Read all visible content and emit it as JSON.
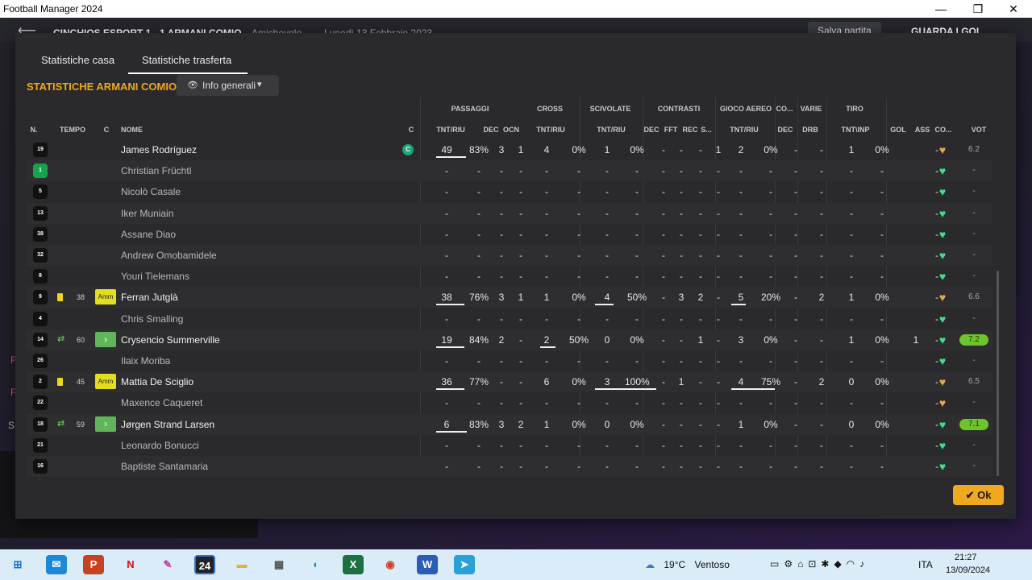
{
  "window": {
    "title": "Football Manager 2024",
    "minimize": "—",
    "maximize": "❐",
    "close": "✕"
  },
  "background": {
    "back": "⟵",
    "score": "CINCHIOS ESPORT 1 - 1 ARMANI COMIO",
    "competition": "Amichevole",
    "date": "Lunedì 13 Febbraio 2023",
    "save": "Salva partita",
    "watch": "GUARDA I GOL",
    "side_letters": [
      "F",
      "F",
      "S"
    ]
  },
  "modal": {
    "tabs": [
      "Statistiche casa",
      "Statistiche trasferta"
    ],
    "team_title": "STATISTICHE ARMANI COMIO",
    "dropdown": {
      "icon": "eye-icon",
      "label": "Info generali",
      "chevron": "⌄"
    },
    "ok_label": "Ok"
  },
  "groups": [
    "PASSAGGI",
    "CROSS",
    "SCIVOLATE",
    "CONTRASTI",
    "GIOCO AEREO",
    "CO...",
    "VARIE",
    "TIRO"
  ],
  "columns": [
    "N.",
    "TEMPO",
    "C",
    "NOME",
    "C",
    "TNT/RIU",
    "DEC",
    "OCN",
    "TNT/RIU",
    "TNT/RIU",
    "DEC",
    "FFT",
    "REC",
    "S...",
    "TNT/RIU",
    "DEC",
    "DRB",
    "TNT\\INP",
    "GOL",
    "ASS",
    "CO...",
    "VOT"
  ],
  "players": [
    {
      "n": "19",
      "gk": false,
      "name": "James Rodríguez",
      "event": "",
      "minute": "",
      "badge": "",
      "captain": "C",
      "pt": "49",
      "pr": "83%",
      "pd": "3",
      "po": "1",
      "ct": "4",
      "cr": "0%",
      "st": "1",
      "sr": "0%",
      "kd": "-",
      "kf": "-",
      "kr": "-",
      "ks": "1",
      "at": "2",
      "ar": "0%",
      "od": "-",
      "vd": "-",
      "tt": "1",
      "ti": "0%",
      "gol": "",
      "ass": "-",
      "mood": "orange",
      "vot": "6.2",
      "good": false,
      "pbar": 0.58,
      "cbar": 0,
      "sbar": 0,
      "abar": 0
    },
    {
      "n": "1",
      "gk": true,
      "name": "Christian Früchtl",
      "event": "",
      "minute": "",
      "badge": "",
      "captain": "",
      "pt": "-",
      "pr": "-",
      "pd": "-",
      "po": "-",
      "ct": "-",
      "cr": "-",
      "st": "-",
      "sr": "-",
      "kd": "-",
      "kf": "-",
      "kr": "-",
      "ks": "-",
      "at": "-",
      "ar": "-",
      "od": "-",
      "vd": "-",
      "tt": "-",
      "ti": "-",
      "gol": "",
      "ass": "-",
      "mood": "green",
      "vot": "-",
      "good": false,
      "pbar": 0,
      "cbar": 0,
      "sbar": 0,
      "abar": 0
    },
    {
      "n": "5",
      "gk": false,
      "name": "Nicolò Casale",
      "event": "",
      "minute": "",
      "badge": "",
      "captain": "",
      "pt": "-",
      "pr": "-",
      "pd": "-",
      "po": "-",
      "ct": "-",
      "cr": "-",
      "st": "-",
      "sr": "-",
      "kd": "-",
      "kf": "-",
      "kr": "-",
      "ks": "-",
      "at": "-",
      "ar": "-",
      "od": "-",
      "vd": "-",
      "tt": "-",
      "ti": "-",
      "gol": "",
      "ass": "-",
      "mood": "green",
      "vot": "-",
      "good": false,
      "pbar": 0,
      "cbar": 0,
      "sbar": 0,
      "abar": 0
    },
    {
      "n": "13",
      "gk": false,
      "name": "Iker Muniain",
      "event": "",
      "minute": "",
      "badge": "",
      "captain": "",
      "pt": "-",
      "pr": "-",
      "pd": "-",
      "po": "-",
      "ct": "-",
      "cr": "-",
      "st": "-",
      "sr": "-",
      "kd": "-",
      "kf": "-",
      "kr": "-",
      "ks": "-",
      "at": "-",
      "ar": "-",
      "od": "-",
      "vd": "-",
      "tt": "-",
      "ti": "-",
      "gol": "",
      "ass": "-",
      "mood": "green",
      "vot": "-",
      "good": false,
      "pbar": 0,
      "cbar": 0,
      "sbar": 0,
      "abar": 0
    },
    {
      "n": "38",
      "gk": false,
      "name": "Assane Diao",
      "event": "",
      "minute": "",
      "badge": "",
      "captain": "",
      "pt": "-",
      "pr": "-",
      "pd": "-",
      "po": "-",
      "ct": "-",
      "cr": "-",
      "st": "-",
      "sr": "-",
      "kd": "-",
      "kf": "-",
      "kr": "-",
      "ks": "-",
      "at": "-",
      "ar": "-",
      "od": "-",
      "vd": "-",
      "tt": "-",
      "ti": "-",
      "gol": "",
      "ass": "-",
      "mood": "green",
      "vot": "-",
      "good": false,
      "pbar": 0,
      "cbar": 0,
      "sbar": 0,
      "abar": 0
    },
    {
      "n": "32",
      "gk": false,
      "name": "Andrew Omobamidele",
      "event": "",
      "minute": "",
      "badge": "",
      "captain": "",
      "pt": "-",
      "pr": "-",
      "pd": "-",
      "po": "-",
      "ct": "-",
      "cr": "-",
      "st": "-",
      "sr": "-",
      "kd": "-",
      "kf": "-",
      "kr": "-",
      "ks": "-",
      "at": "-",
      "ar": "-",
      "od": "-",
      "vd": "-",
      "tt": "-",
      "ti": "-",
      "gol": "",
      "ass": "-",
      "mood": "green",
      "vot": "-",
      "good": false,
      "pbar": 0,
      "cbar": 0,
      "sbar": 0,
      "abar": 0
    },
    {
      "n": "8",
      "gk": false,
      "name": "Youri Tielemans",
      "event": "",
      "minute": "",
      "badge": "",
      "captain": "",
      "pt": "-",
      "pr": "-",
      "pd": "-",
      "po": "-",
      "ct": "-",
      "cr": "-",
      "st": "-",
      "sr": "-",
      "kd": "-",
      "kf": "-",
      "kr": "-",
      "ks": "-",
      "at": "-",
      "ar": "-",
      "od": "-",
      "vd": "-",
      "tt": "-",
      "ti": "-",
      "gol": "",
      "ass": "-",
      "mood": "green",
      "vot": "-",
      "good": false,
      "pbar": 0,
      "cbar": 0,
      "sbar": 0,
      "abar": 0
    },
    {
      "n": "9",
      "gk": false,
      "name": "Ferran Jutglà",
      "event": "yellow",
      "minute": "38",
      "badge": "Amm",
      "captain": "",
      "pt": "38",
      "pr": "76%",
      "pd": "3",
      "po": "1",
      "ct": "1",
      "cr": "0%",
      "st": "4",
      "sr": "50%",
      "kd": "-",
      "kf": "3",
      "kr": "2",
      "ks": "-",
      "at": "5",
      "ar": "20%",
      "od": "-",
      "vd": "2",
      "tt": "1",
      "ti": "0%",
      "gol": "",
      "ass": "-",
      "mood": "orange",
      "vot": "6.6",
      "good": false,
      "pbar": 0.54,
      "cbar": 0,
      "sbar": 0.3,
      "abar": 0.25
    },
    {
      "n": "4",
      "gk": false,
      "name": "Chris Smalling",
      "event": "",
      "minute": "",
      "badge": "",
      "captain": "",
      "pt": "-",
      "pr": "-",
      "pd": "-",
      "po": "-",
      "ct": "-",
      "cr": "-",
      "st": "-",
      "sr": "-",
      "kd": "-",
      "kf": "-",
      "kr": "-",
      "ks": "-",
      "at": "-",
      "ar": "-",
      "od": "-",
      "vd": "-",
      "tt": "-",
      "ti": "-",
      "gol": "",
      "ass": "-",
      "mood": "green",
      "vot": "-",
      "good": false,
      "pbar": 0,
      "cbar": 0,
      "sbar": 0,
      "abar": 0
    },
    {
      "n": "14",
      "gk": false,
      "name": "Crysencio Summerville",
      "event": "sub",
      "minute": "60",
      "badge": "›",
      "captain": "",
      "pt": "19",
      "pr": "84%",
      "pd": "2",
      "po": "-",
      "ct": "2",
      "cr": "50%",
      "st": "0",
      "sr": "0%",
      "kd": "-",
      "kf": "-",
      "kr": "1",
      "ks": "-",
      "at": "3",
      "ar": "0%",
      "od": "-",
      "vd": "-",
      "tt": "1",
      "ti": "0%",
      "gol": "1",
      "ass": "-",
      "mood": "green",
      "vot": "7.2",
      "good": true,
      "pbar": 0.55,
      "cbar": 0.3,
      "sbar": 0,
      "abar": 0
    },
    {
      "n": "26",
      "gk": false,
      "name": "Ilaix Moriba",
      "event": "",
      "minute": "",
      "badge": "",
      "captain": "",
      "pt": "-",
      "pr": "-",
      "pd": "-",
      "po": "-",
      "ct": "-",
      "cr": "-",
      "st": "-",
      "sr": "-",
      "kd": "-",
      "kf": "-",
      "kr": "-",
      "ks": "-",
      "at": "-",
      "ar": "-",
      "od": "-",
      "vd": "-",
      "tt": "-",
      "ti": "-",
      "gol": "",
      "ass": "-",
      "mood": "green",
      "vot": "-",
      "good": false,
      "pbar": 0,
      "cbar": 0,
      "sbar": 0,
      "abar": 0
    },
    {
      "n": "2",
      "gk": false,
      "name": "Mattia De Sciglio",
      "event": "yellow",
      "minute": "45",
      "badge": "Amm",
      "captain": "",
      "pt": "36",
      "pr": "77%",
      "pd": "-",
      "po": "-",
      "ct": "6",
      "cr": "0%",
      "st": "3",
      "sr": "100%",
      "kd": "-",
      "kf": "1",
      "kr": "-",
      "ks": "-",
      "at": "4",
      "ar": "75%",
      "od": "-",
      "vd": "2",
      "tt": "0",
      "ti": "0%",
      "gol": "",
      "ass": "-",
      "mood": "orange",
      "vot": "6.5",
      "good": false,
      "pbar": 0.55,
      "cbar": 0,
      "sbar": 1,
      "abar": 0.75
    },
    {
      "n": "22",
      "gk": false,
      "name": "Maxence Caqueret",
      "event": "",
      "minute": "",
      "badge": "",
      "captain": "",
      "pt": "-",
      "pr": "-",
      "pd": "-",
      "po": "-",
      "ct": "-",
      "cr": "-",
      "st": "-",
      "sr": "-",
      "kd": "-",
      "kf": "-",
      "kr": "-",
      "ks": "-",
      "at": "-",
      "ar": "-",
      "od": "-",
      "vd": "-",
      "tt": "-",
      "ti": "-",
      "gol": "",
      "ass": "-",
      "mood": "orange",
      "vot": "-",
      "good": false,
      "pbar": 0,
      "cbar": 0,
      "sbar": 0,
      "abar": 0
    },
    {
      "n": "18",
      "gk": false,
      "name": "Jørgen Strand Larsen",
      "event": "sub",
      "minute": "59",
      "badge": "›",
      "captain": "",
      "pt": "6",
      "pr": "83%",
      "pd": "3",
      "po": "2",
      "ct": "1",
      "cr": "0%",
      "st": "0",
      "sr": "0%",
      "kd": "-",
      "kf": "-",
      "kr": "-",
      "ks": "-",
      "at": "1",
      "ar": "0%",
      "od": "-",
      "vd": "-",
      "tt": "0",
      "ti": "0%",
      "gol": "",
      "ass": "-",
      "mood": "green",
      "vot": "7.1",
      "good": true,
      "pbar": 0.6,
      "cbar": 0,
      "sbar": 0,
      "abar": 0
    },
    {
      "n": "21",
      "gk": false,
      "name": "Leonardo Bonucci",
      "event": "",
      "minute": "",
      "badge": "",
      "captain": "",
      "pt": "-",
      "pr": "-",
      "pd": "-",
      "po": "-",
      "ct": "-",
      "cr": "-",
      "st": "-",
      "sr": "-",
      "kd": "-",
      "kf": "-",
      "kr": "-",
      "ks": "-",
      "at": "-",
      "ar": "-",
      "od": "-",
      "vd": "-",
      "tt": "-",
      "ti": "-",
      "gol": "",
      "ass": "-",
      "mood": "green",
      "vot": "-",
      "good": false,
      "pbar": 0,
      "cbar": 0,
      "sbar": 0,
      "abar": 0
    },
    {
      "n": "16",
      "gk": false,
      "name": "Baptiste Santamaria",
      "event": "",
      "minute": "",
      "badge": "",
      "captain": "",
      "pt": "-",
      "pr": "-",
      "pd": "-",
      "po": "-",
      "ct": "-",
      "cr": "-",
      "st": "-",
      "sr": "-",
      "kd": "-",
      "kf": "-",
      "kr": "-",
      "ks": "-",
      "at": "-",
      "ar": "-",
      "od": "-",
      "vd": "-",
      "tt": "-",
      "ti": "-",
      "gol": "",
      "ass": "-",
      "mood": "green",
      "vot": "-",
      "good": false,
      "pbar": 0,
      "cbar": 0,
      "sbar": 0,
      "abar": 0
    }
  ],
  "taskbar": {
    "apps": [
      {
        "name": "windows-start-icon",
        "glyph": "⊞",
        "color": "#1e6fd0",
        "bg": "transparent"
      },
      {
        "name": "mail-icon",
        "glyph": "✉",
        "color": "#fff",
        "bg": "#1e88d8"
      },
      {
        "name": "powerpoint-icon",
        "glyph": "P",
        "color": "#fff",
        "bg": "#c9421f"
      },
      {
        "name": "netflix-icon",
        "glyph": "N",
        "color": "#e50914",
        "bg": "transparent"
      },
      {
        "name": "paint-icon",
        "glyph": "✎",
        "color": "#c040a0",
        "bg": "transparent"
      },
      {
        "name": "football-manager-icon",
        "glyph": "24",
        "color": "#fff",
        "bg": "#222"
      },
      {
        "name": "file-explorer-icon",
        "glyph": "▬",
        "color": "#e8b421",
        "bg": "transparent"
      },
      {
        "name": "calculator-icon",
        "glyph": "▦",
        "color": "#555",
        "bg": "transparent"
      },
      {
        "name": "edge-icon",
        "glyph": "◐",
        "color": "#1d8ad8",
        "bg": "transparent"
      },
      {
        "name": "excel-icon",
        "glyph": "X",
        "color": "#fff",
        "bg": "#1d7040"
      },
      {
        "name": "chrome-icon",
        "glyph": "◉",
        "color": "#d23a2a",
        "bg": "transparent"
      },
      {
        "name": "word-icon",
        "glyph": "W",
        "color": "#fff",
        "bg": "#2b5cb8"
      },
      {
        "name": "telegram-icon",
        "glyph": "➤",
        "color": "#fff",
        "bg": "#2aa0d8"
      }
    ],
    "weather_temp": "19°C",
    "weather_desc": "Ventoso",
    "lang": "ITA",
    "time": "21:27",
    "date": "13/09/2024"
  }
}
